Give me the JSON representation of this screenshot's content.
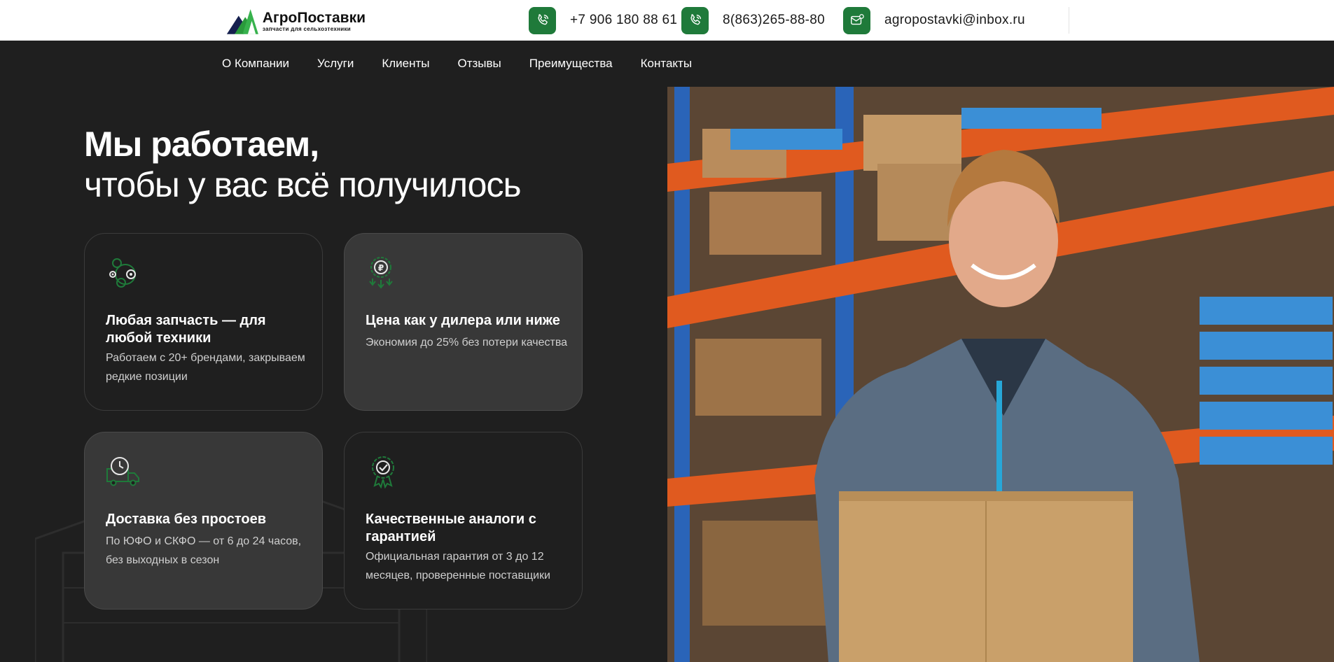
{
  "header": {
    "logo_title": "АгроПоставки",
    "logo_subtitle": "запчасти для сельхозтехники",
    "phone1": "+7 906 180 88 61",
    "phone2": "8(863)265-88-80",
    "email": "agropostavki@inbox.ru"
  },
  "nav": {
    "items": [
      "О Компании",
      "Услуги",
      "Клиенты",
      "Отзывы",
      "Преимущества",
      "Контакты"
    ]
  },
  "hero": {
    "title_bold": "Мы работаем,",
    "title_regular": "чтобы у вас всё получилось"
  },
  "cards": [
    {
      "icon": "gears-icon",
      "title": "Любая запчасть — для любой техники",
      "text": "Работаем с 20+ брендами, закрываем редкие позиции"
    },
    {
      "icon": "ruble-down-icon",
      "title": "Цена как у дилера или ниже",
      "text": "Экономия до 25% без потери качества"
    },
    {
      "icon": "delivery-truck-icon",
      "title": "Доставка без простоев",
      "text": "По ЮФО и СКФО — от 6 до 24 часов, без выходных в сезон"
    },
    {
      "icon": "quality-badge-icon",
      "title": "Качественные аналоги с гарантией",
      "text": "Официальная гарантия от 3 до 12 месяцев, проверенные поставщики"
    }
  ],
  "colors": {
    "accent": "#1f7a3a",
    "background": "#1f1f1f",
    "card_light": "#383838",
    "header": "#ffffff"
  }
}
